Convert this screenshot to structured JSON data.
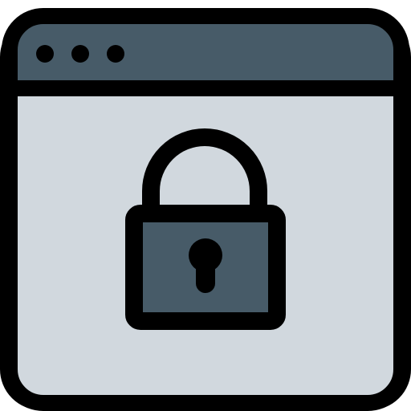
{
  "icon": {
    "name": "browser-window-lock-icon",
    "parts": {
      "window": "browser-window-icon",
      "titlebar_dots": [
        "window-dot-icon",
        "window-dot-icon",
        "window-dot-icon"
      ],
      "lock": "padlock-icon",
      "keyhole": "keyhole-icon"
    }
  },
  "colors": {
    "outline": "#000000",
    "titlebar": "#475b68",
    "window_body": "#d1d8de",
    "lock_body": "#475b68",
    "background": "#ffffff"
  }
}
